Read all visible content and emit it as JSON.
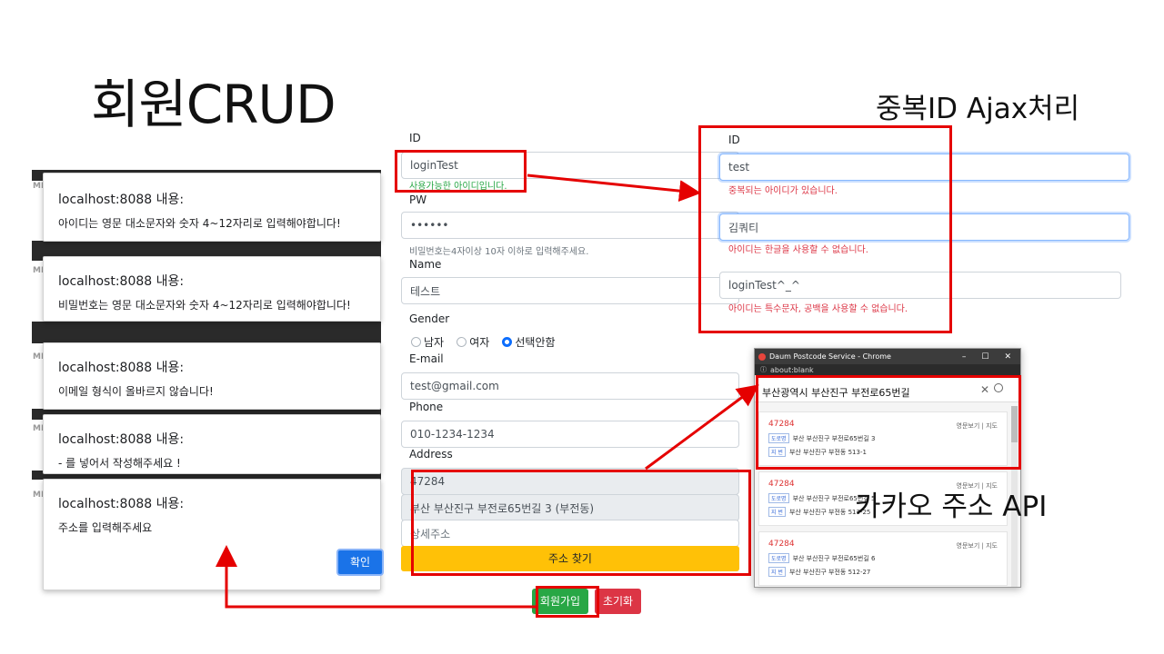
{
  "slide": {
    "title": "회원CRUD",
    "label_duplicate": "중복ID Ajax처리",
    "label_kakao": "카카오 주소 API"
  },
  "alerts": {
    "side_mark": "MD",
    "items": [
      {
        "title": "localhost:8088 내용:",
        "message": "아이디는 영문 대소문자와 숫자 4~12자리로 입력해야합니다!"
      },
      {
        "title": "localhost:8088 내용:",
        "message": "비밀번호는 영문 대소문자와 숫자 4~12자리로 입력해야합니다!"
      },
      {
        "title": "localhost:8088 내용:",
        "message": "이메일 형식이 올바르지 않습니다!"
      },
      {
        "title": "localhost:8088 내용:",
        "message": "- 를 넣어서 작성해주세요 !"
      },
      {
        "title": "localhost:8088 내용:",
        "message": "주소를 입력해주세요"
      }
    ],
    "ok_label": "확인"
  },
  "form": {
    "id_label": "ID",
    "id_value": "loginTest",
    "id_help": "사용가능한 아이디입니다.",
    "pw_label": "PW",
    "pw_value": "••••••",
    "pw_help": "비밀번호는4자이상 10자 이하로 입력해주세요.",
    "name_label": "Name",
    "name_value": "테스트",
    "gender_label": "Gender",
    "gender_options": [
      "남자",
      "여자",
      "선택안함"
    ],
    "gender_selected": "선택안함",
    "email_label": "E-mail",
    "email_value": "test@gmail.com",
    "phone_label": "Phone",
    "phone_value": "010-1234-1234",
    "address_label": "Address",
    "zip_value": "47284",
    "road_value": "부산 부산진구 부전로65번길 3 (부전동)",
    "detail_placeholder": "상세주소",
    "find_address_label": "주소 찾기",
    "submit_label": "회원가입",
    "reset_label": "초기화"
  },
  "duplicate_panel": {
    "id_label": "ID",
    "case1_value": "test",
    "case1_error": "중복되는 아이디가 있습니다.",
    "case2_value": "김쿼티",
    "case2_error": "아이디는 한글을 사용할 수 없습니다.",
    "case3_value": "loginTest^_^",
    "case3_error": "아이디는 특수문자, 공백을 사용할 수 없습니다."
  },
  "postcode_window": {
    "title": "Daum Postcode Service - Chrome",
    "address_bar": "about:blank",
    "controls": [
      "–",
      "☐",
      "✕"
    ],
    "search_value": "부산광역시 부산진구 부전로65번길",
    "road_tag": "도로명",
    "jibun_tag": "지 번",
    "link_english": "영문보기",
    "link_map": "지도",
    "results": [
      {
        "zip": "47284",
        "road": "부산 부산진구 부전로65번길 3",
        "jibun": "부산 부산진구 부전동 513-1"
      },
      {
        "zip": "47284",
        "road": "부산 부산진구 부전로65번길 5",
        "jibun": "부산 부산진구 부전동 513-25"
      },
      {
        "zip": "47284",
        "road": "부산 부산진구 부전로65번길 6",
        "jibun": "부산 부산진구 부전동 512-27"
      }
    ]
  },
  "colors": {
    "annotation_red": "#e50000",
    "success_green": "#28a745",
    "error_red": "#dc3545",
    "primary_blue": "#0d6efd",
    "warning_yellow": "#ffc107"
  }
}
